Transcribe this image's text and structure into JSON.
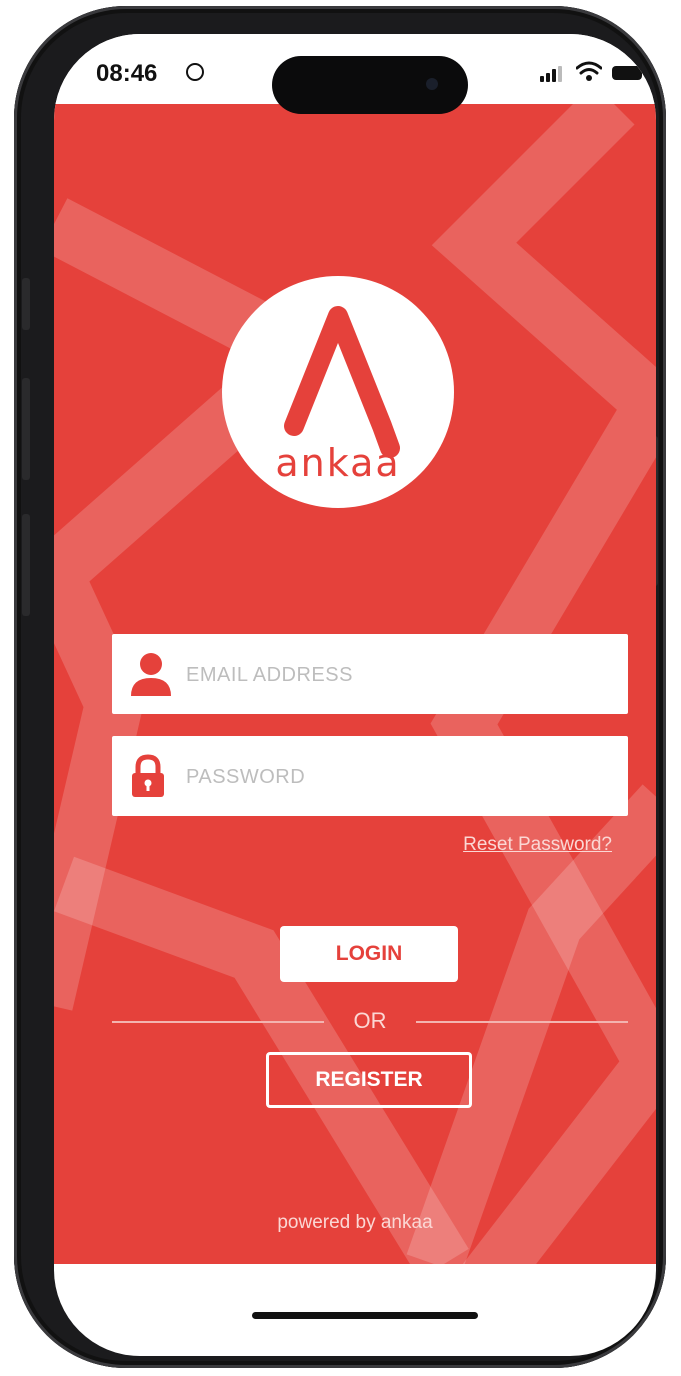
{
  "status_bar": {
    "time": "08:46",
    "icons": [
      "face-id-indicator-icon",
      "signal-bars-icon",
      "wifi-icon",
      "battery-icon"
    ]
  },
  "logo": {
    "letter": "A",
    "wordmark": "ankaa"
  },
  "login_form": {
    "email_placeholder": "EMAIL ADDRESS",
    "password_placeholder": "PASSWORD",
    "reset_link": "Reset Password?",
    "login_label": "LOGIN",
    "or_text": "OR",
    "register_label": "REGISTER"
  },
  "footer": {
    "powered_by": "powered by ankaa"
  },
  "colors": {
    "brand_red": "#e5413b",
    "white": "#ffffff"
  }
}
